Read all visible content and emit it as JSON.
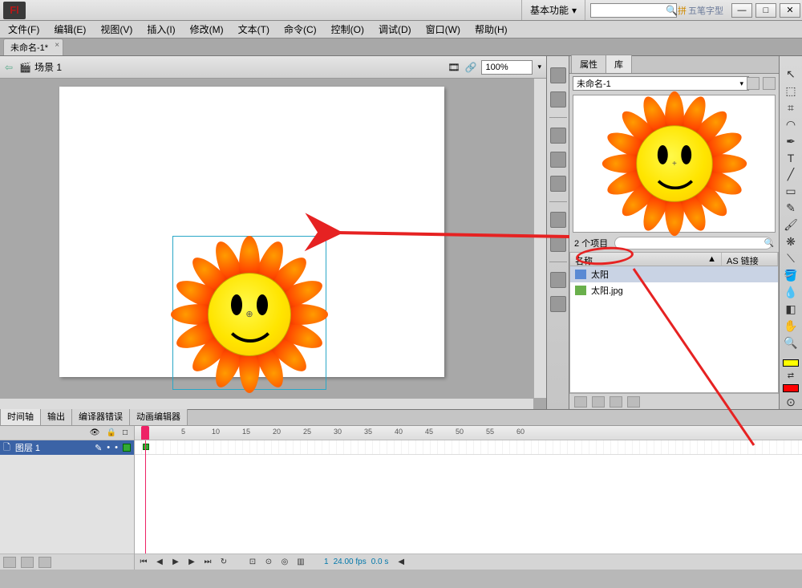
{
  "title_dropdown": "基本功能",
  "ime": "五笔字型",
  "menubar": {
    "file": "文件(F)",
    "edit": "编辑(E)",
    "view": "视图(V)",
    "insert": "插入(I)",
    "modify": "修改(M)",
    "text": "文本(T)",
    "commands": "命令(C)",
    "control": "控制(O)",
    "debug": "调试(D)",
    "window": "窗口(W)",
    "help": "帮助(H)"
  },
  "doc_tab": "未命名-1*",
  "scene": {
    "label": "场景 1",
    "zoom": "100%"
  },
  "panels": {
    "properties_tab": "属性",
    "library_tab": "库",
    "file_select": "未命名-1",
    "item_count": "2 个项目",
    "col_name": "名称",
    "col_linkage": "AS 链接",
    "items": [
      {
        "name": "太阳",
        "selected": true
      },
      {
        "name": "太阳.jpg",
        "selected": false
      }
    ]
  },
  "timeline": {
    "tab_timeline": "时间轴",
    "tab_output": "输出",
    "tab_compile": "编译器错误",
    "tab_motion": "动画编辑器",
    "layer_name": "图层 1",
    "ruler_marks": [
      "5",
      "10",
      "15",
      "20",
      "25",
      "30",
      "35",
      "40",
      "45",
      "50",
      "55",
      "60"
    ],
    "current_frame": "1",
    "fps": "24.00 fps",
    "time": "0.0 s"
  },
  "search_placeholder": ""
}
